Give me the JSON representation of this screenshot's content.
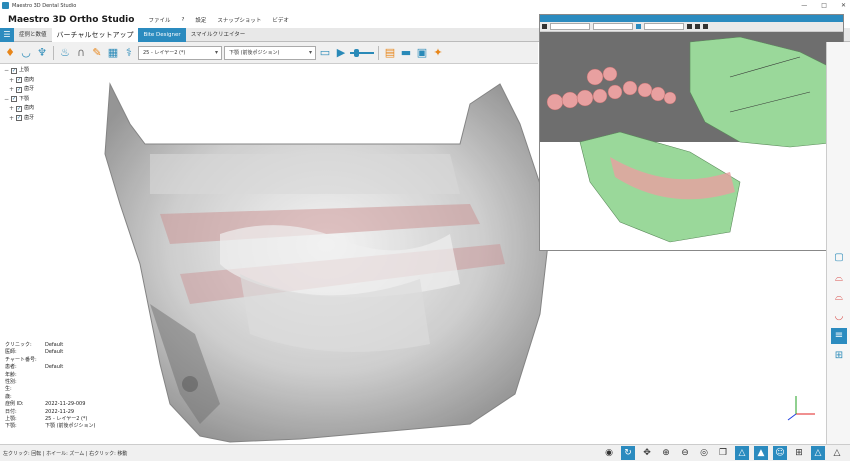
{
  "window": {
    "title": "Maestro 3D Dental Studio"
  },
  "menu": {
    "brand": "Maestro 3D Ortho Studio",
    "items": [
      "ファイル",
      "?",
      "設定",
      "スナップショット",
      "ビデオ"
    ]
  },
  "tabs": [
    "症例と数値",
    "バーチャルセットアップ",
    "Bite Designer",
    "スマイルクリエイター"
  ],
  "toolbar": {
    "layer_select": "25 - レイヤー2 (*)",
    "position_select": "下顎 (前後ポジション)"
  },
  "tree": [
    {
      "label": "上顎",
      "level": 0,
      "expander": "-"
    },
    {
      "label": "歯肉",
      "level": 1,
      "expander": "+"
    },
    {
      "label": "歯牙",
      "level": 1,
      "expander": "+"
    },
    {
      "label": "下顎",
      "level": 0,
      "expander": "-"
    },
    {
      "label": "歯肉",
      "level": 1,
      "expander": "+"
    },
    {
      "label": "歯牙",
      "level": 1,
      "expander": "+"
    }
  ],
  "info": [
    {
      "label": "クリニック:",
      "value": "Default"
    },
    {
      "label": "医師:",
      "value": "Default"
    },
    {
      "label": "チャート番号:",
      "value": ""
    },
    {
      "label": "患者:",
      "value": "Default"
    },
    {
      "label": "年齢:",
      "value": ""
    },
    {
      "label": "性別:",
      "value": ""
    },
    {
      "label": "生:",
      "value": ""
    },
    {
      "label": "歳:",
      "value": ""
    },
    {
      "label": "症例 ID:",
      "value": "2022-11-29-009"
    },
    {
      "label": "日付:",
      "value": "2022-11-29"
    },
    {
      "label": "上顎:",
      "value": "25 - レイヤー2 (*)"
    },
    {
      "label": "下顎:",
      "value": "下顎 (前後ポジション)"
    }
  ],
  "status": {
    "hint": "左クリック: 回転 | ホイール: ズーム | 右クリック: 移動"
  },
  "colors": {
    "accent": "#2b8bbf",
    "bone": "#9ad89a",
    "teeth": "#e8a0a0"
  }
}
